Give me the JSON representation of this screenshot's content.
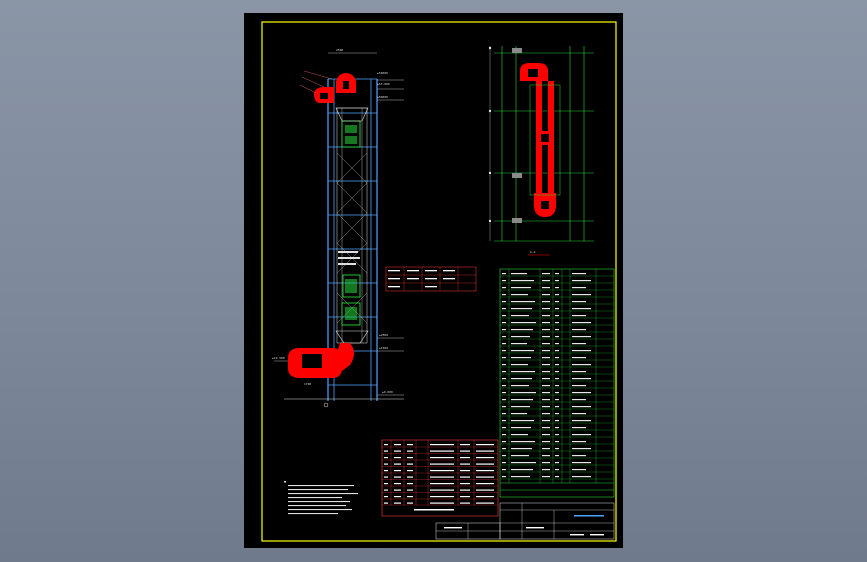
{
  "drawing": {
    "title_block": {
      "drawing_title": "",
      "notes_visible": true
    },
    "elevation_labels": {
      "top_1": "±56000",
      "top_2": "±53.000",
      "top_3": "±50000",
      "mid_1": "±2500",
      "mid_2": "±1500",
      "bottom": "±0.000",
      "left_marker": "±10.500",
      "bottom_dim": "1700"
    },
    "side_view_caption": "A-A",
    "colors": {
      "frame": "#ffff00",
      "structure": "#4fa3ff",
      "equipment": "#ff0000",
      "table_lines": "#27d83a",
      "text": "#ffffff",
      "background": "#000000"
    }
  }
}
